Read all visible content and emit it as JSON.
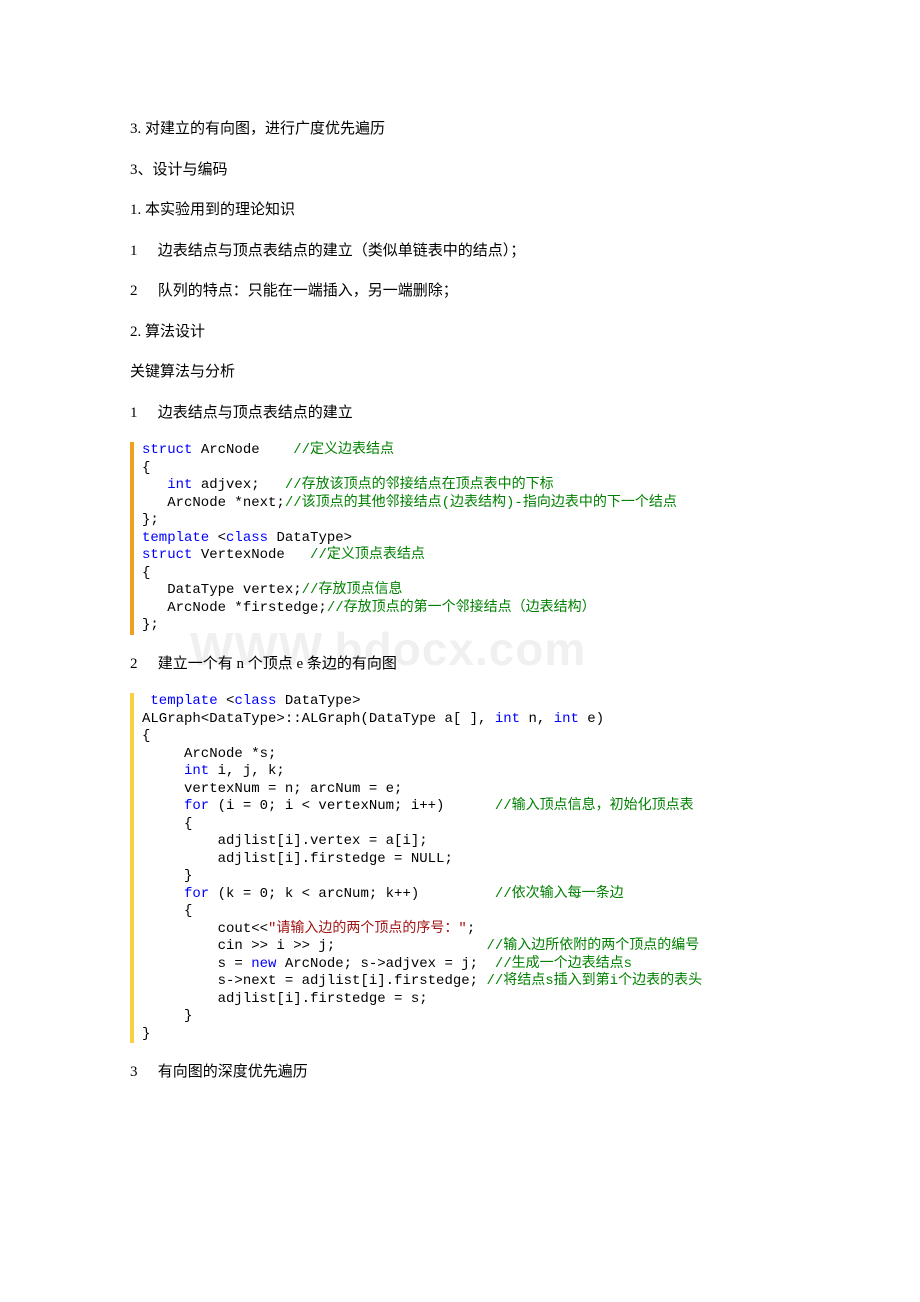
{
  "watermark": "WWW.bdocx.com",
  "p1": "3. 对建立的有向图，进行广度优先遍历",
  "p2": "3、设计与编码",
  "p3": "1. 本实验用到的理论知识",
  "p4_num": "1",
  "p4": "边表结点与顶点表结点的建立（类似单链表中的结点）；",
  "p5_num": "2",
  "p5": "队列的特点：只能在一端插入，另一端删除；",
  "p6": "2. 算法设计",
  "p7": " 关键算法与分析",
  "p8_num": "1",
  "p8": "边表结点与顶点表结点的建立",
  "code1": {
    "l1a": "struct",
    "l1b": " ArcNode    ",
    "l1c": "//定义边表结点",
    "l2": "{",
    "l3a": "   int",
    "l3b": " adjvex;   ",
    "l3c": "//存放该顶点的邻接结点在顶点表中的下标",
    "l4a": "   ArcNode *next;",
    "l4b": "//该顶点的其他邻接结点(边表结构)-指向边表中的下一个结点",
    "l5": "};",
    "l6a": "template",
    "l6b": " <",
    "l6c": "class",
    "l6d": " DataType>",
    "l7a": "struct",
    "l7b": " VertexNode   ",
    "l7c": "//定义顶点表结点",
    "l8": "{",
    "l9a": "   DataType vertex;",
    "l9b": "//存放顶点信息",
    "l10a": "   ArcNode *firstedge;",
    "l10b": "//存放顶点的第一个邻接结点（边表结构）",
    "l11": "};"
  },
  "p9_num": "2",
  "p9": "建立一个有 n 个顶点 e 条边的有向图",
  "code2": {
    "l1a": " template",
    "l1b": " <",
    "l1c": "class",
    "l1d": " DataType>",
    "l2a": "ALGraph<DataType>::ALGraph(DataType a[ ], ",
    "l2b": "int",
    "l2c": " n, ",
    "l2d": "int",
    "l2e": " e)",
    "l3": "{",
    "l4": "     ArcNode *s;",
    "l5a": "     int",
    "l5b": " i, j, k;",
    "l6": "     vertexNum = n; arcNum = e;",
    "l7a": "     for",
    "l7b": " (i = 0; i < vertexNum; i++)      ",
    "l7c": "//输入顶点信息，初始化顶点表",
    "l8": "     {",
    "l9": "         adjlist[i].vertex = a[i];",
    "l10": "         adjlist[i].firstedge = NULL;",
    "l11": "     }",
    "l12a": "     for",
    "l12b": " (k = 0; k < arcNum; k++)         ",
    "l12c": "//依次输入每一条边",
    "l13": "     {",
    "l14a": "         cout<<",
    "l14b": "\"请输入边的两个顶点的序号：\"",
    "l14c": ";",
    "l15a": "         cin >> i >> j;                  ",
    "l15b": "//输入边所依附的两个顶点的编号",
    "l16a": "         s = ",
    "l16b": "new",
    "l16c": " ArcNode; s->adjvex = j;  ",
    "l16d": "//生成一个边表结点s",
    "l17a": "         s->next = adjlist[i].firstedge; ",
    "l17b": "//将结点s插入到第i个边表的表头",
    "l18": "         adjlist[i].firstedge = s;",
    "l19": "     }",
    "l20": "}"
  },
  "p10_num": "3",
  "p10": "有向图的深度优先遍历"
}
